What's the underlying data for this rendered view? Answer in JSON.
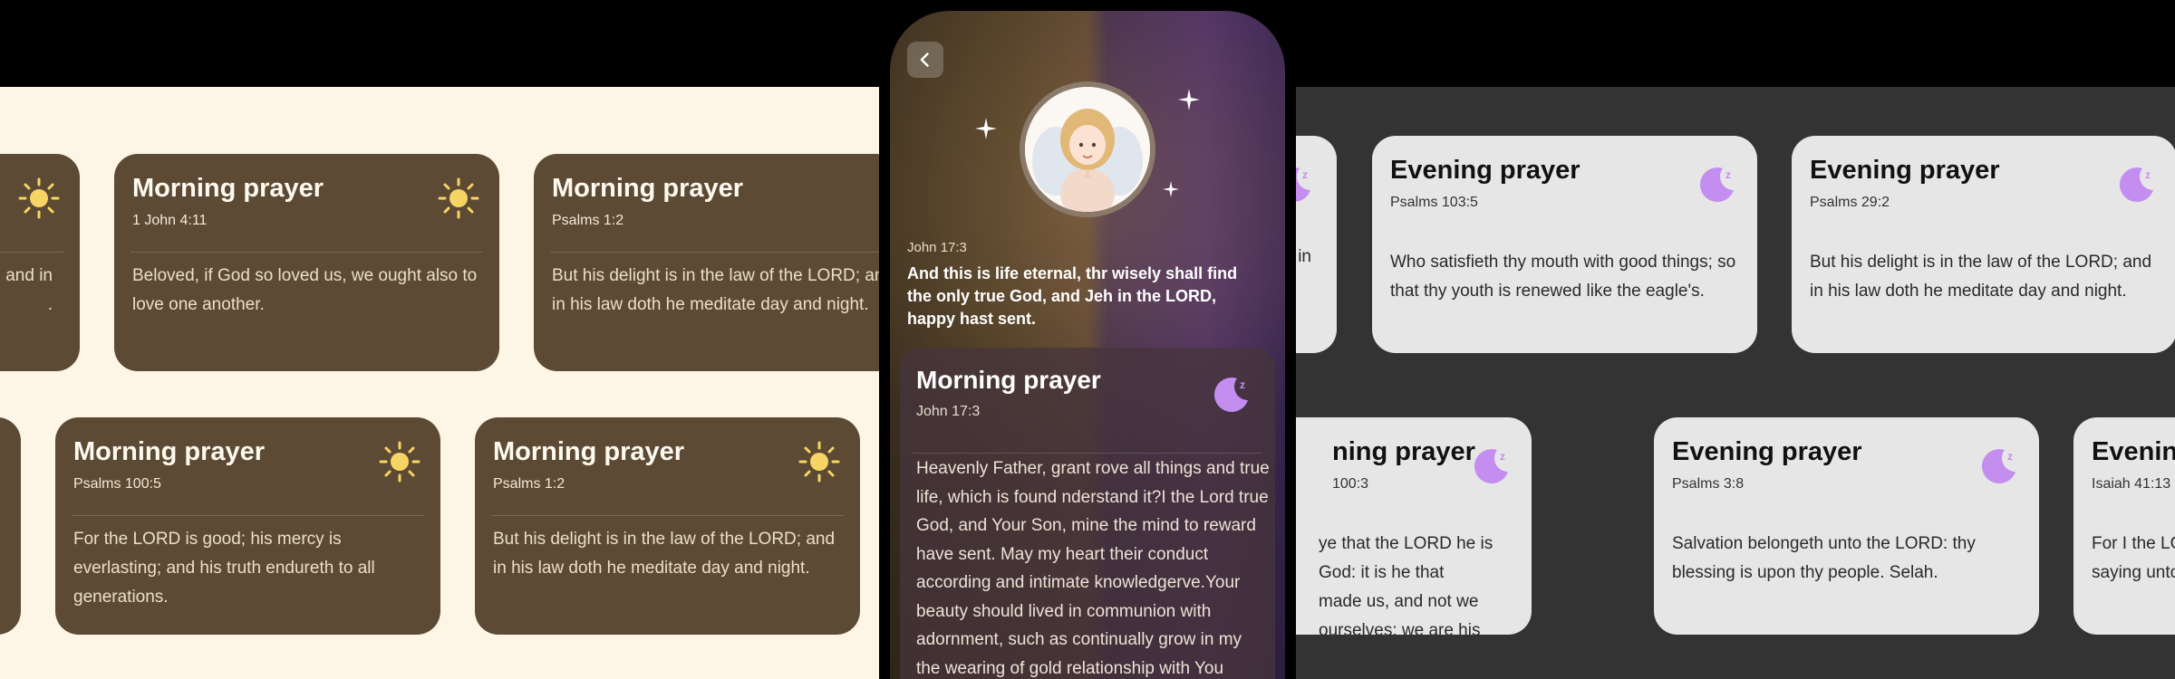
{
  "colors": {
    "morning_bg": "#fdf6e6",
    "morning_card": "#5c4a35",
    "evening_bg": "#333333",
    "evening_card": "#e6e6e6",
    "sun": "#f7d565",
    "moon": "#c48ef0"
  },
  "morning_cards": [
    {
      "title": "",
      "ref": "",
      "body": "; and in\n."
    },
    {
      "title": "Morning prayer",
      "ref": "1 John 4:11",
      "body": "Beloved, if God so loved us, we ought also to love one another."
    },
    {
      "title": "Morning prayer",
      "ref": "Psalms 1:2",
      "body": "But his delight is in the law of the LORD; and in his law doth he meditate day and night."
    },
    {
      "title": "Morning prayer",
      "ref": "Psalms 100:5",
      "body": "For the LORD is good; his mercy is everlasting; and his truth endureth to all generations."
    },
    {
      "title": "Morning prayer",
      "ref": "Psalms 1:2",
      "body": "But his delight is in the law of the LORD; and in his law doth he meditate day and night."
    }
  ],
  "evening_cards": [
    {
      "title": "",
      "ref": "",
      "body": "in"
    },
    {
      "title": "Evening prayer",
      "ref": "Psalms 103:5",
      "body": "Who satisfieth thy mouth with good things; so that thy youth is renewed like the eagle's."
    },
    {
      "title": "Evening prayer",
      "ref": "Psalms 29:2",
      "body": "But his delight is in the law of the LORD; and in his law doth he meditate day and night."
    },
    {
      "title": "ning prayer",
      "ref": "100:3",
      "body": "ye that the LORD he is God: it is he that made us, and not we ourselves; we are his e, and the sheep of his pasture"
    },
    {
      "title": "Evening prayer",
      "ref": "Psalms 3:8",
      "body": "Salvation belongeth unto the LORD: thy blessing is upon thy people. Selah."
    },
    {
      "title": "Evening",
      "ref": "Isaiah 41:13",
      "body": "For I the LO saying unto"
    }
  ],
  "phone": {
    "back_icon": "chevron-left-icon",
    "verse_ref": "John 17:3",
    "verse_text": "And this is life eternal, thr wisely shall find the only true God, and Jeh in the LORD, happy hast sent.",
    "detail": {
      "title": "Morning prayer",
      "ref": "John 17:3",
      "icon": "moon-sleep-icon",
      "body": "Heavenly Father, grant rove all things and true life, which is found nderstand it?I the Lord true God, and Your Son, mine the mind to reward have sent. May my heart their conduct according and intimate knowledgerve.Your beauty should lived in communion with adornment, such as continually grow in my  the wearing of gold relationship with You anather, it should be that of"
    }
  }
}
